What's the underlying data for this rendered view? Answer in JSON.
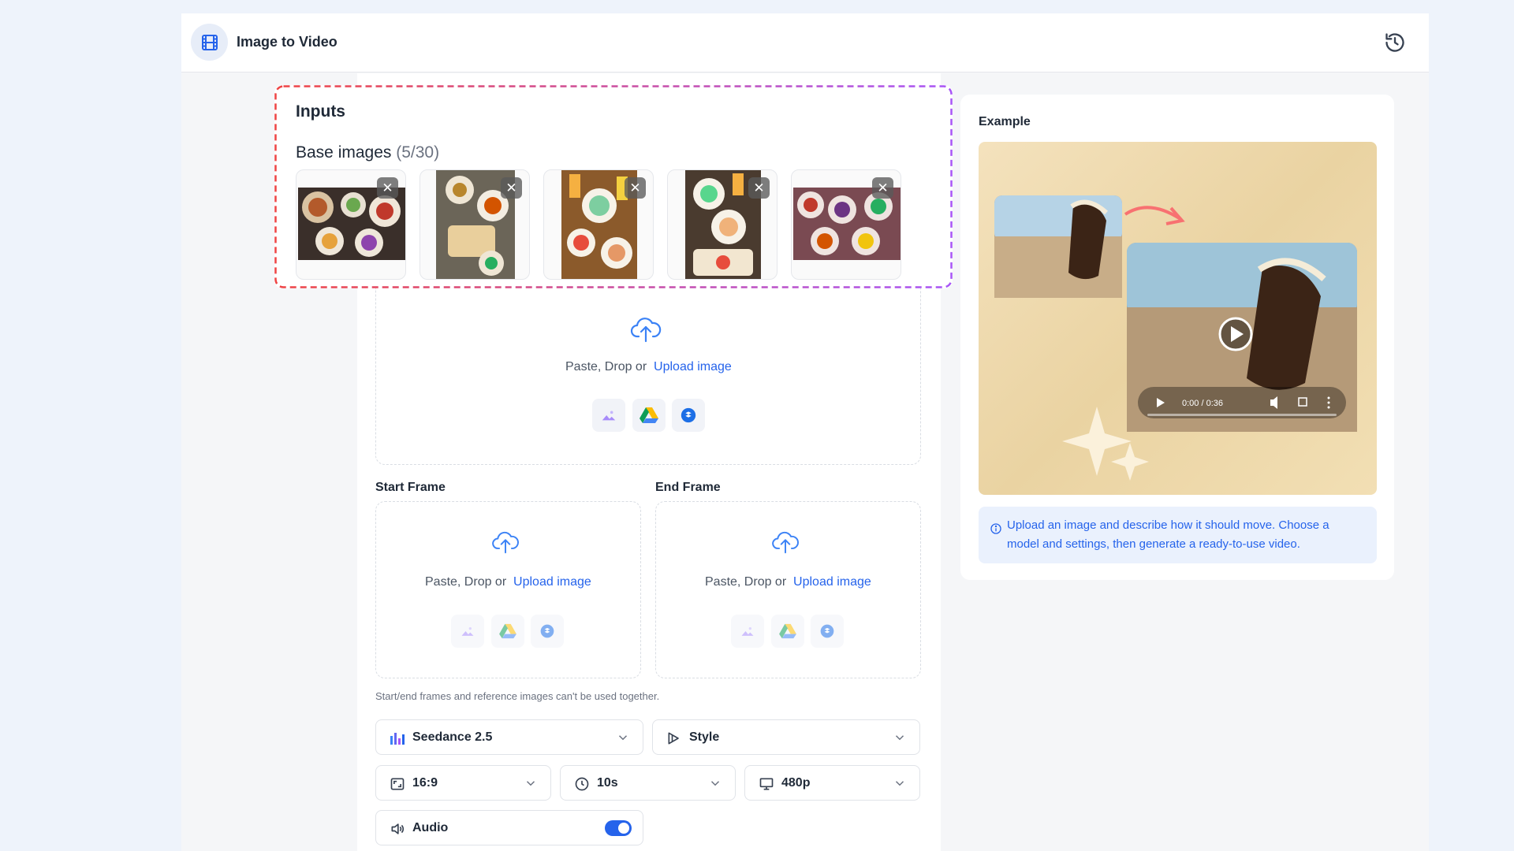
{
  "header": {
    "title": "Image to Video",
    "app_icon": "film-icon",
    "history_icon": "history-icon"
  },
  "inputs": {
    "title": "Inputs",
    "base_images_label": "Base images",
    "base_images_count": "(5/30)",
    "thumbnails": [
      {
        "name": "food-image-1",
        "close_icon": "close-icon"
      },
      {
        "name": "food-image-2",
        "close_icon": "close-icon"
      },
      {
        "name": "food-image-3",
        "close_icon": "close-icon"
      },
      {
        "name": "food-image-4",
        "close_icon": "close-icon"
      },
      {
        "name": "food-image-5",
        "close_icon": "close-icon"
      }
    ],
    "highlight_colors": [
      "#ef4444",
      "#a855f7"
    ]
  },
  "upload": {
    "prefix": "Paste, Drop or",
    "link": "Upload image",
    "sources": [
      "gallery-icon",
      "google-drive-icon",
      "dropbox-icon"
    ]
  },
  "frames": {
    "start_label": "Start Frame",
    "end_label": "End Frame",
    "prefix": "Paste, Drop or",
    "link": "Upload image"
  },
  "note": "Start/end frames and reference images can't be used together.",
  "settings": {
    "model": "Seedance 2.5",
    "style": "Style",
    "aspect_ratio": "16:9",
    "duration": "10s",
    "resolution": "480p",
    "audio_label": "Audio",
    "audio_enabled": true
  },
  "example": {
    "title": "Example",
    "video_time": "0:00 / 0:36",
    "info_text": "Upload an image and describe how it should move. Choose a model and settings, then generate a ready-to-use video."
  },
  "colors": {
    "accent": "#2563eb",
    "info_bg": "#eaf1fd",
    "page_bg": "#eef3fb"
  }
}
